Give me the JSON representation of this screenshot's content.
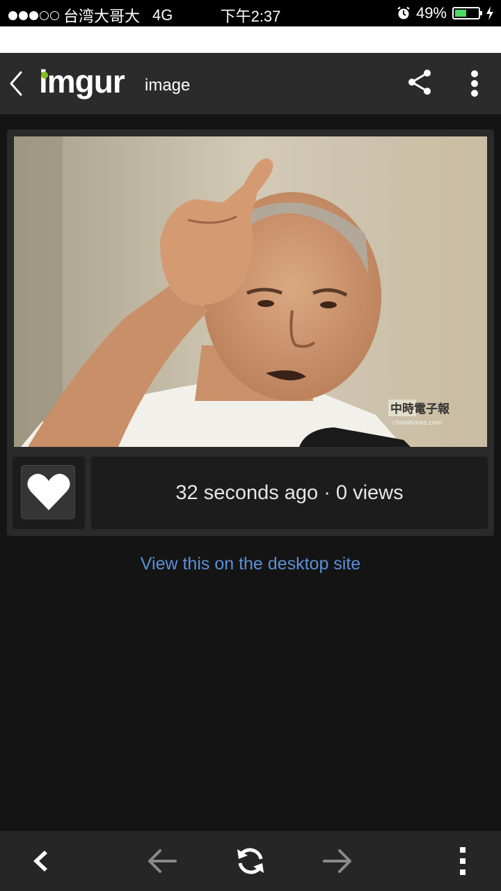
{
  "status_bar": {
    "carrier": "台湾大哥大",
    "network": "4G",
    "time": "下午2:37",
    "battery_percent": "49%",
    "battery_level": 0.49
  },
  "header": {
    "logo": "imgur",
    "title": "image"
  },
  "photo": {
    "watermark_brand": "中時電子報",
    "watermark_url": "chinatimes.com"
  },
  "meta": {
    "info": "32 seconds ago · 0 views"
  },
  "links": {
    "desktop": "View this on the desktop site"
  },
  "colors": {
    "accent_green": "#85bf25",
    "link_blue": "#5a8fd6",
    "background": "#141414"
  },
  "icons": [
    "back-chevron-icon",
    "share-icon",
    "more-vertical-icon",
    "heart-icon",
    "back-icon",
    "arrow-left-icon",
    "refresh-icon",
    "arrow-right-icon"
  ]
}
